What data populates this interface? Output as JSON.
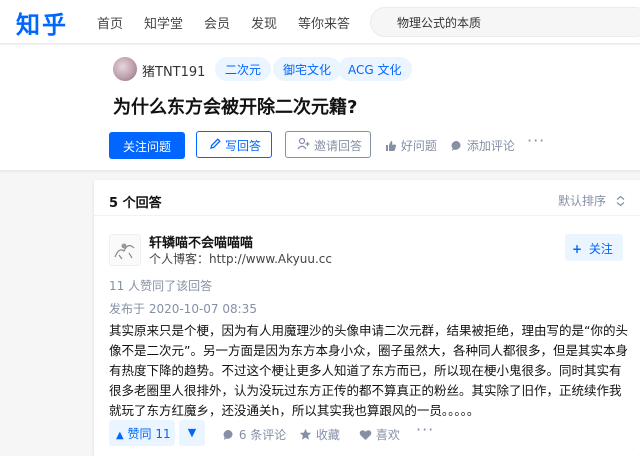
{
  "nav": {
    "logo": "知乎",
    "items": [
      "首页",
      "知学堂",
      "会员",
      "发现",
      "等你来答"
    ],
    "search_value": "物理公式的本质"
  },
  "question": {
    "username": "猪TNT191",
    "tags": [
      "二次元",
      "御宅文化",
      "ACG 文化"
    ],
    "title": "为什么东方会被开除二次元籍?",
    "follow_label": "关注问题",
    "write_label": "写回答",
    "invite_label": "邀请回答",
    "good_label": "好问题",
    "comment_label": "添加评论",
    "more": "···"
  },
  "answers": {
    "count_label": "5 个回答",
    "sort_label": "默认排序",
    "author_name": "轩辚喵不会喵喵喵",
    "author_bio": "个人博客：http://www.Akyuu.cc",
    "follow_label": "关注",
    "upvote_note": "11 人赞同了该回答",
    "pub_time": "发布于 2020-10-07 08:35",
    "content": "其实原来只是个梗，因为有人用魔理沙的头像申请二次元群，结果被拒绝，理由写的是“你的头像不是二次元”。另一方面是因为东方本身小众，圈子虽然大，各种同人都很多，但是其实本身有热度下降的趋势。不过这个梗让更多人知道了东方而已，所以现在梗小鬼很多。同时其实有很多老圈里人很排外，认为没玩过东方正传的都不算真正的粉丝。其实除了旧作，正统续作我就玩了东方红魔乡，还没通关h，所以其实我也算跟风的一员。。。。。",
    "vote_label": "赞同 11",
    "comments_label": "6 条评论",
    "collect_label": "收藏",
    "like_label": "喜欢",
    "more": "···"
  },
  "colors": {
    "brand": "#0066ff",
    "muted": "#8590a6",
    "tag_bg": "#ebf5ff"
  }
}
